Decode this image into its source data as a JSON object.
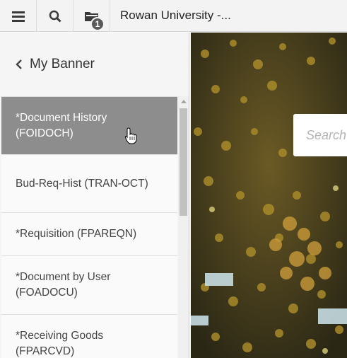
{
  "topbar": {
    "title": "Rowan University -...",
    "menu_icon": "hamburger-icon",
    "search_icon": "search-icon",
    "folder_icon": "folder-icon",
    "notification_count": "1"
  },
  "sidebar": {
    "header": "My Banner",
    "items": [
      {
        "label": "*Document History (FOIDOCH)",
        "active": true
      },
      {
        "label": "Bud-Req-Hist (TRAN-OCT)"
      },
      {
        "label": "*Requisition (FPAREQN)"
      },
      {
        "label": "*Document by User (FOADOCU)"
      },
      {
        "label": "*Receiving Goods (FPARCVD)"
      }
    ]
  },
  "main": {
    "search_placeholder": "Search"
  },
  "colors": {
    "active_item": "#8d8d8d",
    "topbar_bg": "#f3f3f3",
    "sidebar_bg": "#f5f5f5"
  }
}
